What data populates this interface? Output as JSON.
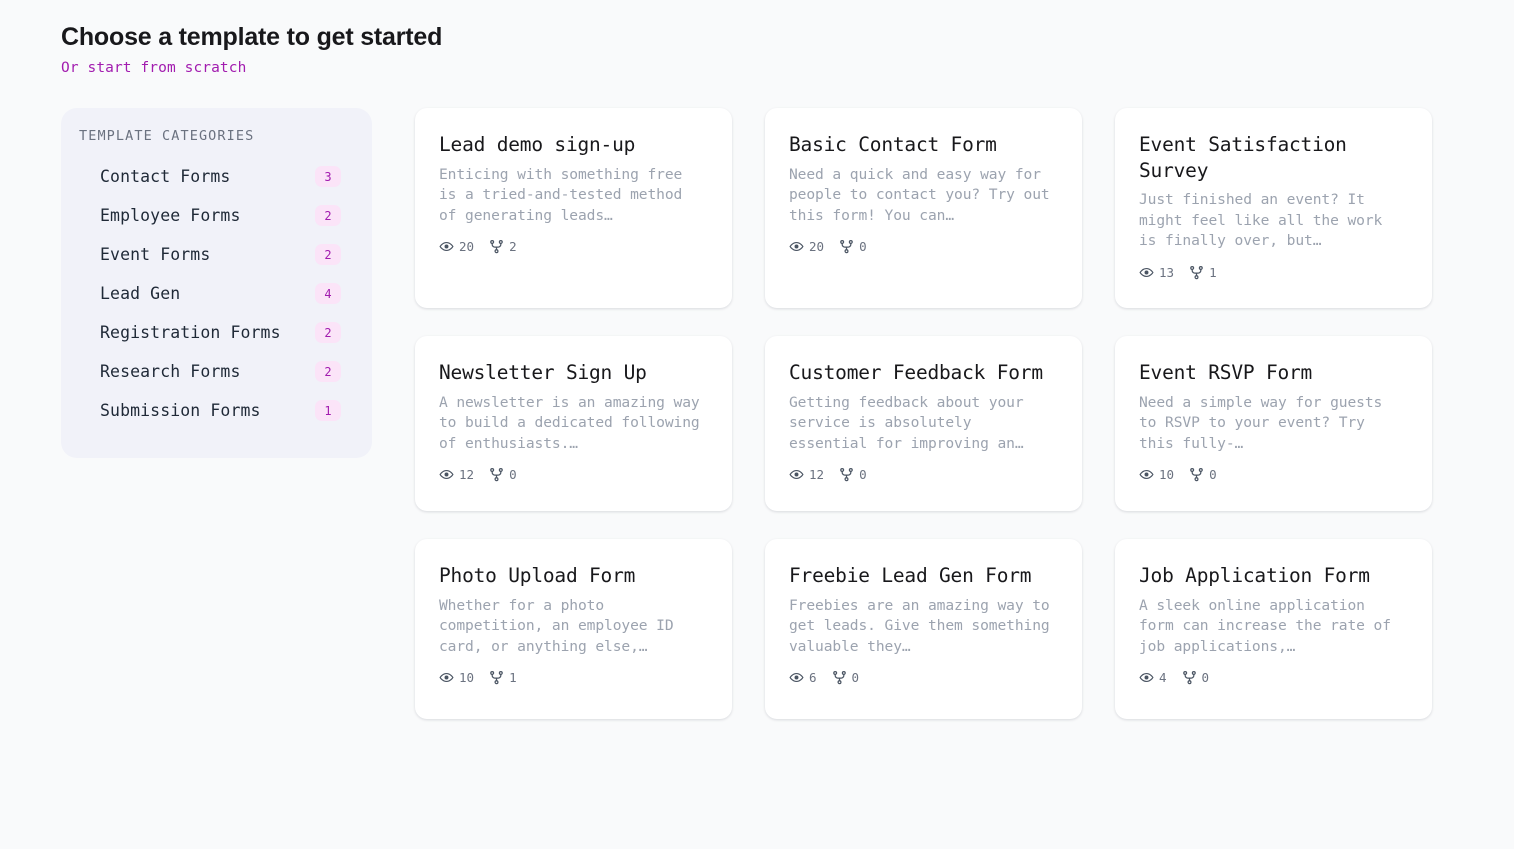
{
  "header": {
    "title": "Choose a template to get started",
    "scratch_link": "Or start from scratch"
  },
  "sidebar": {
    "heading": "TEMPLATE CATEGORIES",
    "items": [
      {
        "label": "Contact Forms",
        "count": "3"
      },
      {
        "label": "Employee Forms",
        "count": "2"
      },
      {
        "label": "Event Forms",
        "count": "2"
      },
      {
        "label": "Lead Gen",
        "count": "4"
      },
      {
        "label": "Registration Forms",
        "count": "2"
      },
      {
        "label": "Research Forms",
        "count": "2"
      },
      {
        "label": "Submission Forms",
        "count": "1"
      }
    ]
  },
  "icons": {
    "views": "eye-icon",
    "forks": "fork-icon"
  },
  "templates": [
    {
      "title": "Lead demo sign-up",
      "description": "Enticing with something free is a tried-and-tested method of generating leads…",
      "views": "20",
      "forks": "2"
    },
    {
      "title": "Basic Contact Form",
      "description": "Need a quick and easy way for people to contact you? Try out this form! You can…",
      "views": "20",
      "forks": "0"
    },
    {
      "title": "Event Satisfaction Survey",
      "description": "Just finished an event? It might feel like all the work is finally over, but…",
      "views": "13",
      "forks": "1"
    },
    {
      "title": "Newsletter Sign Up",
      "description": "A newsletter is an amazing way to build a dedicated following of enthusiasts.…",
      "views": "12",
      "forks": "0"
    },
    {
      "title": "Customer Feedback Form",
      "description": "Getting feedback about your service is absolutely essential for improving an…",
      "views": "12",
      "forks": "0"
    },
    {
      "title": "Event RSVP Form",
      "description": "Need a simple way for guests to RSVP to your event? Try this fully-…",
      "views": "10",
      "forks": "0"
    },
    {
      "title": "Photo Upload Form",
      "description": "Whether for a photo competition, an employee ID card, or anything else,…",
      "views": "10",
      "forks": "1"
    },
    {
      "title": "Freebie Lead Gen Form",
      "description": "Freebies are an amazing way to get leads. Give them something valuable they…",
      "views": "6",
      "forks": "0"
    },
    {
      "title": "Job Application Form",
      "description": "A sleek online application form can increase the rate of job applications,…",
      "views": "4",
      "forks": "0"
    }
  ],
  "colors": {
    "accent": "#a21caf",
    "badge_bg": "#fbe4f8",
    "sidebar_bg": "#f1f2f9",
    "page_bg": "#f9fafb",
    "card_bg": "#ffffff"
  }
}
